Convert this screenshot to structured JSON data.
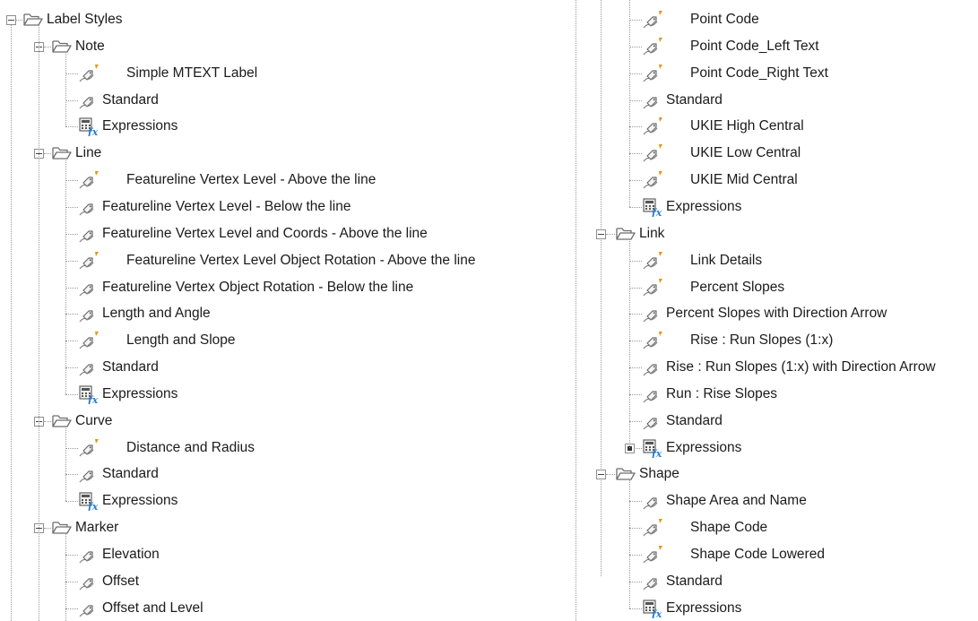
{
  "left_tree": {
    "root": "Label Styles",
    "groups": [
      {
        "name": "Note",
        "items": [
          {
            "label": "Simple MTEXT Label",
            "type": "style",
            "flag": true
          },
          {
            "label": "Standard",
            "type": "style",
            "flag": false
          },
          {
            "label": "Expressions",
            "type": "expressions"
          }
        ]
      },
      {
        "name": "Line",
        "items": [
          {
            "label": "Featureline Vertex Level - Above the line",
            "type": "style",
            "flag": true
          },
          {
            "label": "Featureline Vertex Level - Below the line",
            "type": "style",
            "flag": false
          },
          {
            "label": "Featureline Vertex Level and Coords - Above the line",
            "type": "style",
            "flag": false
          },
          {
            "label": "Featureline Vertex Level Object Rotation - Above the line",
            "type": "style",
            "flag": true
          },
          {
            "label": "Featureline Vertex Object Rotation - Below the line",
            "type": "style",
            "flag": false
          },
          {
            "label": "Length and Angle",
            "type": "style",
            "flag": false
          },
          {
            "label": "Length and Slope",
            "type": "style",
            "flag": true
          },
          {
            "label": "Standard",
            "type": "style",
            "flag": false
          },
          {
            "label": "Expressions",
            "type": "expressions"
          }
        ]
      },
      {
        "name": "Curve",
        "items": [
          {
            "label": "Distance and Radius",
            "type": "style",
            "flag": true
          },
          {
            "label": "Standard",
            "type": "style",
            "flag": false
          },
          {
            "label": "Expressions",
            "type": "expressions"
          }
        ]
      },
      {
        "name": "Marker",
        "items": [
          {
            "label": "Elevation",
            "type": "style",
            "flag": false
          },
          {
            "label": "Offset",
            "type": "style",
            "flag": false
          },
          {
            "label": "Offset and Level",
            "type": "style",
            "flag": false
          }
        ]
      }
    ]
  },
  "right_tree": {
    "continued_items": [
      {
        "label": "Point Code",
        "type": "style",
        "flag": true
      },
      {
        "label": "Point Code_Left Text",
        "type": "style",
        "flag": true
      },
      {
        "label": "Point Code_Right Text",
        "type": "style",
        "flag": true
      },
      {
        "label": "Standard",
        "type": "style",
        "flag": false
      },
      {
        "label": "UKIE High Central",
        "type": "style",
        "flag": true
      },
      {
        "label": "UKIE Low Central",
        "type": "style",
        "flag": true
      },
      {
        "label": "UKIE Mid Central",
        "type": "style",
        "flag": true
      },
      {
        "label": "Expressions",
        "type": "expressions"
      }
    ],
    "groups": [
      {
        "name": "Link",
        "items": [
          {
            "label": "Link Details",
            "type": "style",
            "flag": true
          },
          {
            "label": "Percent Slopes",
            "type": "style",
            "flag": true
          },
          {
            "label": "Percent Slopes with Direction Arrow",
            "type": "style",
            "flag": false
          },
          {
            "label": "Rise : Run Slopes (1:x)",
            "type": "style",
            "flag": true
          },
          {
            "label": "Rise : Run Slopes (1:x) with Direction Arrow",
            "type": "style",
            "flag": false
          },
          {
            "label": "Run : Rise Slopes",
            "type": "style",
            "flag": false
          },
          {
            "label": "Standard",
            "type": "style",
            "flag": false
          },
          {
            "label": "Expressions",
            "type": "expressions",
            "expandable": true
          }
        ]
      },
      {
        "name": "Shape",
        "items": [
          {
            "label": "Shape Area and Name",
            "type": "style",
            "flag": false
          },
          {
            "label": "Shape Code",
            "type": "style",
            "flag": true
          },
          {
            "label": "Shape Code Lowered",
            "type": "style",
            "flag": true
          },
          {
            "label": "Standard",
            "type": "style",
            "flag": false
          },
          {
            "label": "Expressions",
            "type": "expressions"
          }
        ]
      }
    ]
  },
  "icons": {
    "folder": "folder-open-icon",
    "style": "label-style-icon",
    "flag": "orange-flag-marker",
    "expressions": "expressions-calculator-icon"
  },
  "colors": {
    "background": "#ffffff",
    "text": "#1b1b1b",
    "tree_lines": "#9a9a9a",
    "flag": "#e8930c",
    "fx": "#2b7fd4",
    "folder_outline": "#6e6e6e"
  }
}
